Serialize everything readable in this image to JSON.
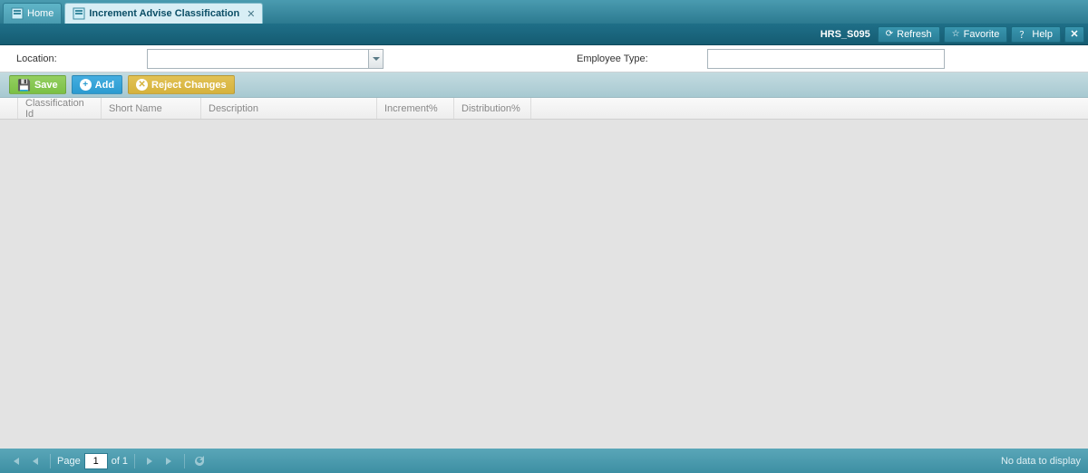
{
  "tabs": {
    "home": "Home",
    "active": "Increment Advise Classification"
  },
  "header": {
    "code": "HRS_S095",
    "refresh": "Refresh",
    "favorite": "Favorite",
    "help": "Help"
  },
  "filters": {
    "location_label": "Location:",
    "location_value": "",
    "emp_type_label": "Employee Type:",
    "emp_type_value": ""
  },
  "actions": {
    "save": "Save",
    "add": "Add",
    "reject": "Reject Changes"
  },
  "columns": {
    "c1": "Classification Id",
    "c2": "Short Name",
    "c3": "Description",
    "c4": "Increment%",
    "c5": "Distribution%"
  },
  "paging": {
    "page_label": "Page",
    "current": "1",
    "of_label": "of 1",
    "empty": "No data to display"
  }
}
